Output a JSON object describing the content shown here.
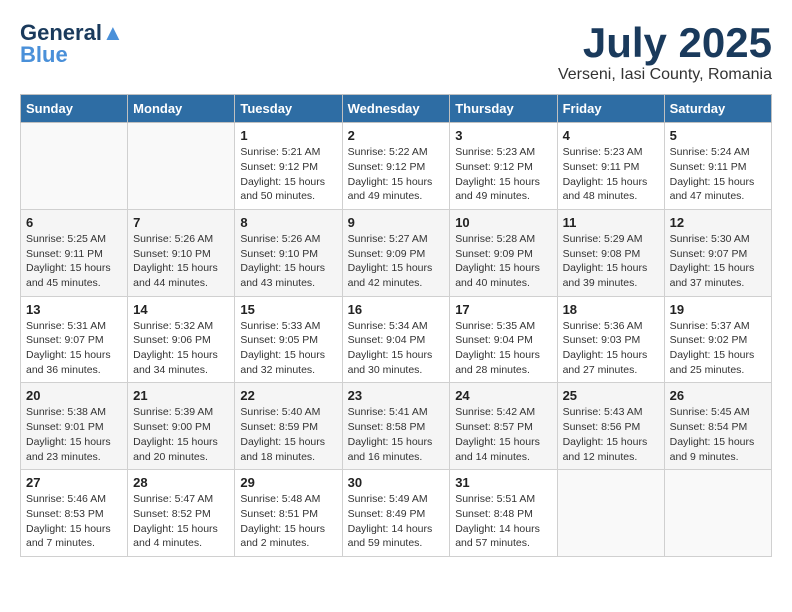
{
  "logo": {
    "line1": "General",
    "line2": "Blue"
  },
  "title": "July 2025",
  "location": "Verseni, Iasi County, Romania",
  "headers": [
    "Sunday",
    "Monday",
    "Tuesday",
    "Wednesday",
    "Thursday",
    "Friday",
    "Saturday"
  ],
  "weeks": [
    [
      {
        "day": "",
        "info": ""
      },
      {
        "day": "",
        "info": ""
      },
      {
        "day": "1",
        "info": "Sunrise: 5:21 AM\nSunset: 9:12 PM\nDaylight: 15 hours and 50 minutes."
      },
      {
        "day": "2",
        "info": "Sunrise: 5:22 AM\nSunset: 9:12 PM\nDaylight: 15 hours and 49 minutes."
      },
      {
        "day": "3",
        "info": "Sunrise: 5:23 AM\nSunset: 9:12 PM\nDaylight: 15 hours and 49 minutes."
      },
      {
        "day": "4",
        "info": "Sunrise: 5:23 AM\nSunset: 9:11 PM\nDaylight: 15 hours and 48 minutes."
      },
      {
        "day": "5",
        "info": "Sunrise: 5:24 AM\nSunset: 9:11 PM\nDaylight: 15 hours and 47 minutes."
      }
    ],
    [
      {
        "day": "6",
        "info": "Sunrise: 5:25 AM\nSunset: 9:11 PM\nDaylight: 15 hours and 45 minutes."
      },
      {
        "day": "7",
        "info": "Sunrise: 5:26 AM\nSunset: 9:10 PM\nDaylight: 15 hours and 44 minutes."
      },
      {
        "day": "8",
        "info": "Sunrise: 5:26 AM\nSunset: 9:10 PM\nDaylight: 15 hours and 43 minutes."
      },
      {
        "day": "9",
        "info": "Sunrise: 5:27 AM\nSunset: 9:09 PM\nDaylight: 15 hours and 42 minutes."
      },
      {
        "day": "10",
        "info": "Sunrise: 5:28 AM\nSunset: 9:09 PM\nDaylight: 15 hours and 40 minutes."
      },
      {
        "day": "11",
        "info": "Sunrise: 5:29 AM\nSunset: 9:08 PM\nDaylight: 15 hours and 39 minutes."
      },
      {
        "day": "12",
        "info": "Sunrise: 5:30 AM\nSunset: 9:07 PM\nDaylight: 15 hours and 37 minutes."
      }
    ],
    [
      {
        "day": "13",
        "info": "Sunrise: 5:31 AM\nSunset: 9:07 PM\nDaylight: 15 hours and 36 minutes."
      },
      {
        "day": "14",
        "info": "Sunrise: 5:32 AM\nSunset: 9:06 PM\nDaylight: 15 hours and 34 minutes."
      },
      {
        "day": "15",
        "info": "Sunrise: 5:33 AM\nSunset: 9:05 PM\nDaylight: 15 hours and 32 minutes."
      },
      {
        "day": "16",
        "info": "Sunrise: 5:34 AM\nSunset: 9:04 PM\nDaylight: 15 hours and 30 minutes."
      },
      {
        "day": "17",
        "info": "Sunrise: 5:35 AM\nSunset: 9:04 PM\nDaylight: 15 hours and 28 minutes."
      },
      {
        "day": "18",
        "info": "Sunrise: 5:36 AM\nSunset: 9:03 PM\nDaylight: 15 hours and 27 minutes."
      },
      {
        "day": "19",
        "info": "Sunrise: 5:37 AM\nSunset: 9:02 PM\nDaylight: 15 hours and 25 minutes."
      }
    ],
    [
      {
        "day": "20",
        "info": "Sunrise: 5:38 AM\nSunset: 9:01 PM\nDaylight: 15 hours and 23 minutes."
      },
      {
        "day": "21",
        "info": "Sunrise: 5:39 AM\nSunset: 9:00 PM\nDaylight: 15 hours and 20 minutes."
      },
      {
        "day": "22",
        "info": "Sunrise: 5:40 AM\nSunset: 8:59 PM\nDaylight: 15 hours and 18 minutes."
      },
      {
        "day": "23",
        "info": "Sunrise: 5:41 AM\nSunset: 8:58 PM\nDaylight: 15 hours and 16 minutes."
      },
      {
        "day": "24",
        "info": "Sunrise: 5:42 AM\nSunset: 8:57 PM\nDaylight: 15 hours and 14 minutes."
      },
      {
        "day": "25",
        "info": "Sunrise: 5:43 AM\nSunset: 8:56 PM\nDaylight: 15 hours and 12 minutes."
      },
      {
        "day": "26",
        "info": "Sunrise: 5:45 AM\nSunset: 8:54 PM\nDaylight: 15 hours and 9 minutes."
      }
    ],
    [
      {
        "day": "27",
        "info": "Sunrise: 5:46 AM\nSunset: 8:53 PM\nDaylight: 15 hours and 7 minutes."
      },
      {
        "day": "28",
        "info": "Sunrise: 5:47 AM\nSunset: 8:52 PM\nDaylight: 15 hours and 4 minutes."
      },
      {
        "day": "29",
        "info": "Sunrise: 5:48 AM\nSunset: 8:51 PM\nDaylight: 15 hours and 2 minutes."
      },
      {
        "day": "30",
        "info": "Sunrise: 5:49 AM\nSunset: 8:49 PM\nDaylight: 14 hours and 59 minutes."
      },
      {
        "day": "31",
        "info": "Sunrise: 5:51 AM\nSunset: 8:48 PM\nDaylight: 14 hours and 57 minutes."
      },
      {
        "day": "",
        "info": ""
      },
      {
        "day": "",
        "info": ""
      }
    ]
  ]
}
